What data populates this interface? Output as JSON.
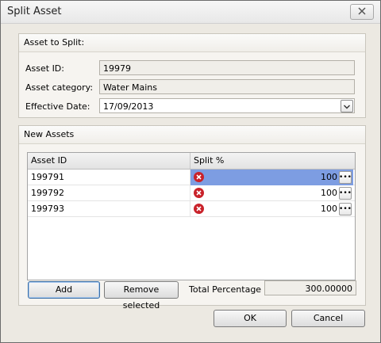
{
  "window": {
    "title": "Split Asset"
  },
  "asset_to_split": {
    "header": "Asset to Split:",
    "asset_id_label": "Asset ID:",
    "asset_id_value": "19979",
    "category_label": "Asset category:",
    "category_value": "Water Mains",
    "date_label": "Effective Date:",
    "date_value": "17/09/2013"
  },
  "new_assets": {
    "header": "New Assets",
    "columns": [
      "Asset ID",
      "Split %"
    ],
    "rows": [
      {
        "asset_id": "199791",
        "split": "100"
      },
      {
        "asset_id": "199792",
        "split": "100"
      },
      {
        "asset_id": "199793",
        "split": "100"
      }
    ],
    "add_label": "Add",
    "remove_label": "Remove selected",
    "total_label": "Total Percentage :",
    "total_value": "300.00000"
  },
  "footer": {
    "ok_label": "OK",
    "cancel_label": "Cancel"
  }
}
